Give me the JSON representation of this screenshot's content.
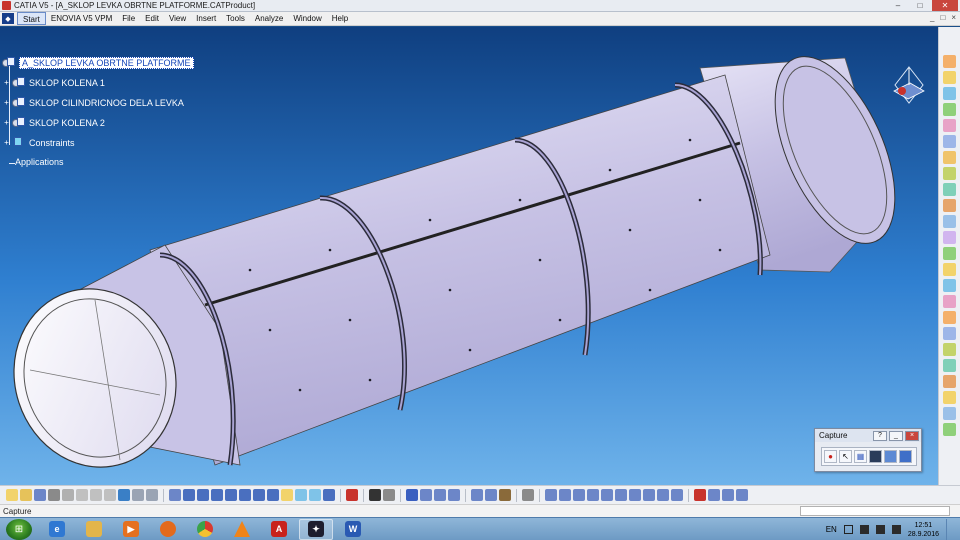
{
  "window": {
    "title": "CATIA V5 - [A_SKLOP LEVKA OBRTNE PLATFORME.CATProduct]",
    "controls": [
      "–",
      "□",
      "✕"
    ]
  },
  "menu": {
    "items": [
      "Start",
      "ENOVIA V5 VPM",
      "File",
      "Edit",
      "View",
      "Insert",
      "Tools",
      "Analyze",
      "Window",
      "Help"
    ],
    "doc_controls": [
      "_",
      "□",
      "×"
    ]
  },
  "tree": {
    "root": "A_SKLOP LEVKA OBRTNE PLATFORME",
    "children": [
      "SKLOP KOLENA 1",
      "SKLOP CILINDRICNOG DELA LEVKA",
      "SKLOP KOLENA 2",
      "Constraints"
    ],
    "applications": "Applications"
  },
  "capture_toolbar": {
    "title": "Capture",
    "help": "?",
    "minimize": "_",
    "close": "×"
  },
  "status": {
    "text": "Capture"
  },
  "taskbar": {
    "language": "EN",
    "time": "12:51",
    "date": "28.9.2016",
    "apps": [
      "internet-explorer",
      "file-explorer",
      "media-player",
      "firefox",
      "chrome",
      "vlc",
      "acrobat",
      "catia",
      "word"
    ]
  },
  "colors": {
    "viewport_top": "#0f3f80",
    "viewport_bottom": "#6fb3ea",
    "part_face": "#c9c4e6",
    "flange": "#9d97c8"
  }
}
